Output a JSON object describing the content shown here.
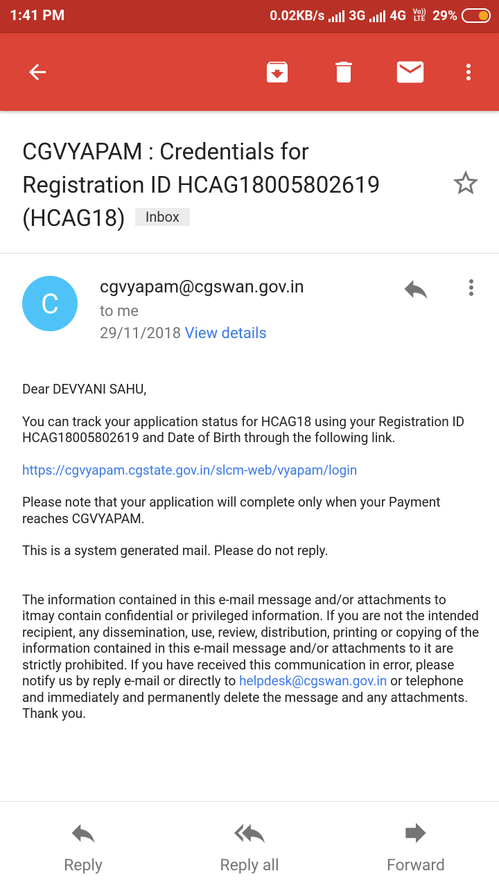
{
  "status_bar": {
    "time": "1:41 PM",
    "speed": "0.02KB/s",
    "network1": "3G",
    "network2": "4G",
    "volte": "Vo)) LTE",
    "battery": "29%",
    "battery_level": 0.29,
    "battery_color": "#f5a623"
  },
  "app_bar": {
    "color": "#db4437",
    "icons": [
      "back-arrow-icon",
      "archive-icon",
      "delete-icon",
      "mark-unread-icon",
      "more-vert-icon"
    ]
  },
  "email": {
    "subject": "CGVYAPAM : Credentials for Registration ID HCAG18005802619 (HCAG18)",
    "label": "Inbox",
    "sender": {
      "initial": "C",
      "address": "cgvyapam@cgswan.gov.in",
      "to": "to me",
      "date": "29/11/2018",
      "details_link": "View details",
      "avatar_color": "#4fc3f7"
    },
    "body": {
      "greeting": "Dear DEVYANI SAHU,",
      "para1": "You can track your application status for HCAG18 using your Registration ID HCAG18005802619 and Date of Birth through the following link.",
      "link": "https://cgvyapam.cgstate.gov.in/slcm-web/vyapam/login",
      "para2": "Please note that your application will complete only when your Payment reaches CGVYAPAM.",
      "para3": "This is a system generated mail. Please do not reply.",
      "disclaimer_start": "The information contained in this e-mail message and/or attachments to itmay contain confidential or privileged information. If you are not the intended recipient, any dissemination, use, review, distribution, printing or copying of the information contained in this e-mail message and/or attachments to it are strictly prohibited. If you have received this communication in error, please notify us by reply e-mail or directly to ",
      "disclaimer_email": "helpdesk@cgswan.gov.in",
      "disclaimer_end": " or telephone and immediately and permanently delete the message and any attachments. Thank you."
    }
  },
  "actions": {
    "reply": "Reply",
    "reply_all": "Reply all",
    "forward": "Forward"
  }
}
